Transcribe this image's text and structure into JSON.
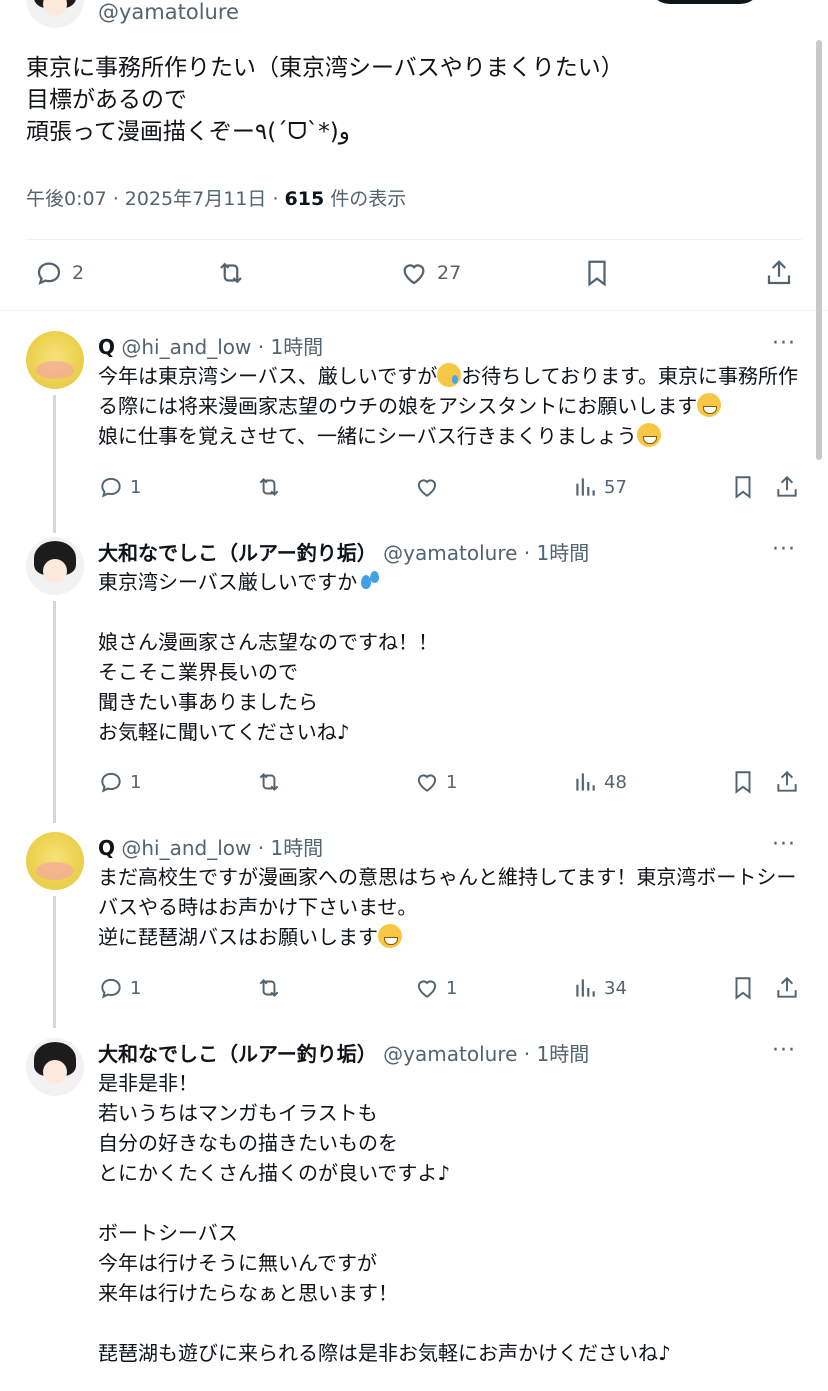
{
  "main_post": {
    "handle": "@yamatolure",
    "text": "東京に事務所作りたい（東京湾シーバスやりまくりたい）\n目標があるので\n頑張って漫画描くぞー٩(ˊᗜˋ*)و",
    "time": "午後0:07 · 2025年7月11日 · ",
    "views_count": "615",
    "views_label": " 件の表示",
    "replies": "2",
    "reposts": "",
    "likes": "27"
  },
  "replies": [
    {
      "name": "Q",
      "handle": "@hi_and_low",
      "time": " · 1時間",
      "more": "···",
      "text_parts": [
        "今年は東京湾シーバス、厳しいですが",
        "お待ちしております。東京に事務所作る際には将来漫画家志望のウチの娘をアシスタントにお願いします",
        "\n娘に仕事を覚えさせて、一緒にシーバス行きまくりましょう"
      ],
      "reply_count": "1",
      "repost_count": "",
      "like_count": "",
      "view_count": "57"
    },
    {
      "name": "大和なでしこ（ルアー釣り垢）",
      "handle": "@yamatolure",
      "time": " · 1時間",
      "more": "···",
      "text_parts": [
        "東京湾シーバス厳しいですか",
        "\n\n娘さん漫画家さん志望なのですね！！\nそこそこ業界長いので\n聞きたい事ありましたら\nお気軽に聞いてくださいね♪"
      ],
      "reply_count": "1",
      "repost_count": "",
      "like_count": "1",
      "view_count": "48"
    },
    {
      "name": "Q",
      "handle": "@hi_and_low",
      "time": " · 1時間",
      "more": "···",
      "text_parts": [
        "まだ高校生ですが漫画家への意思はちゃんと維持してます！東京湾ボートシーバスやる時はお声かけ下さいませ。\n逆に琵琶湖バスはお願いします"
      ],
      "reply_count": "1",
      "repost_count": "",
      "like_count": "1",
      "view_count": "34"
    },
    {
      "name": "大和なでしこ（ルアー釣り垢）",
      "handle": "@yamatolure",
      "time": " · 1時間",
      "more": "···",
      "text_parts": [
        "是非是非！\n若いうちはマンガもイラストも\n自分の好きなもの描きたいものを\nとにかくたくさん描くのが良いですよ♪\n\nボートシーバス\n今年は行けそうに無いんですが\n来年は行けたらなぁと思います！\n\n琵琶湖も遊びに来られる際は是非お気軽にお声かけくださいね♪"
      ]
    }
  ],
  "icons": {
    "reply": "reply-icon",
    "repost": "repost-icon",
    "like": "heart-icon",
    "bookmark": "bookmark-icon",
    "share": "share-icon",
    "views": "views-icon"
  },
  "colors": {
    "text": "#0f1419",
    "secondary": "#536471",
    "divider": "#eff3f4"
  }
}
